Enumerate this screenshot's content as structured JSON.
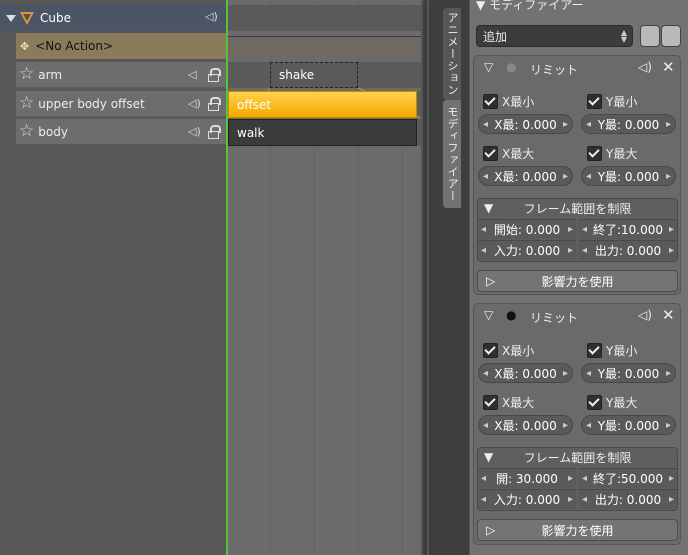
{
  "channels": {
    "object_name": "Cube",
    "no_action": "<No Action>",
    "tracks": [
      {
        "label": "arm"
      },
      {
        "label": "upper body offset"
      },
      {
        "label": "body"
      }
    ]
  },
  "nla": {
    "strips": [
      {
        "label": "shake"
      },
      {
        "label": "offset"
      },
      {
        "label": "walk"
      }
    ]
  },
  "tabs": {
    "animation": "アニメーション",
    "modifiers": "モディファイアー"
  },
  "panel": {
    "title": "モディファイアー",
    "add_dropdown": "追加",
    "modifiers": [
      {
        "name": "リミット",
        "x_min_label": "X最小",
        "y_min_label": "Y最小",
        "x_min_value": "X最:  0.000",
        "y_min_value": "Y最:  0.000",
        "x_max_label": "X最大",
        "y_max_label": "Y最大",
        "x_max_value": "X最:  0.000",
        "y_max_value": "Y最:  0.000",
        "frame_range_label": "フレーム範囲を制限",
        "start": "開始:  0.000",
        "end": "終了:10.000",
        "blend_in": "入力:  0.000",
        "blend_out": "出力:  0.000",
        "influence_label": "影響力を使用"
      },
      {
        "name": "リミット",
        "x_min_label": "X最小",
        "y_min_label": "Y最小",
        "x_min_value": "X最:  0.000",
        "y_min_value": "Y最:  0.000",
        "x_max_label": "X最大",
        "y_max_label": "Y最大",
        "x_max_value": "X最:  0.000",
        "y_max_value": "Y最:  0.000",
        "frame_range_label": "フレーム範囲を制限",
        "start": "開:    30.000",
        "end": "終了:50.000",
        "blend_in": "入力:  0.000",
        "blend_out": "出力:  0.000",
        "influence_label": "影響力を使用"
      }
    ]
  }
}
